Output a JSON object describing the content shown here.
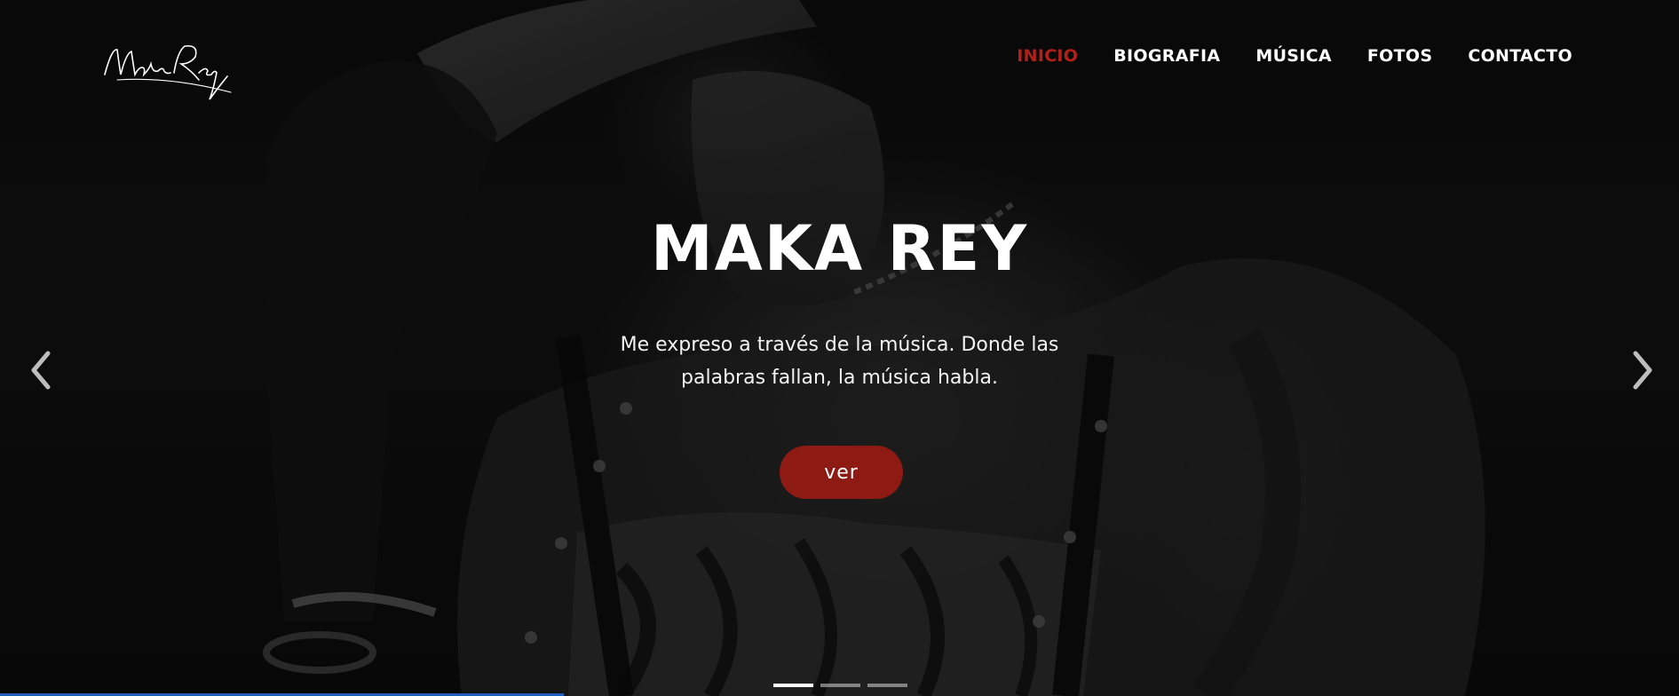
{
  "brand": {
    "logo_text": "Maka Rey"
  },
  "nav": {
    "items": [
      {
        "label": "INICIO",
        "active": true
      },
      {
        "label": "BIOGRAFIA",
        "active": false
      },
      {
        "label": "MÚSICA",
        "active": false
      },
      {
        "label": "FOTOS",
        "active": false
      },
      {
        "label": "CONTACTO",
        "active": false
      }
    ]
  },
  "hero": {
    "title": "MAKA REY",
    "subtitle_line1": "Me expreso a través de la música. Donde las",
    "subtitle_line2": "palabras fallan, la música habla.",
    "cta_label": "ver"
  },
  "carousel": {
    "prev_icon": "chevron-left-icon",
    "next_icon": "chevron-right-icon",
    "slides": 3,
    "active_index": 0
  },
  "colors": {
    "accent": "#b3201a",
    "button": "#8e1a14",
    "text": "#ffffff"
  }
}
